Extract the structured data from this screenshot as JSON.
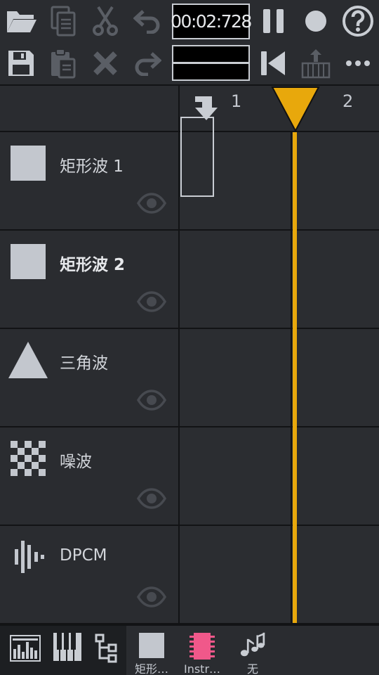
{
  "toolbar": {
    "time": "00:02:728",
    "icons_row1": [
      "open-folder-icon",
      "copy-icon",
      "cut-icon",
      "undo-icon",
      "pause-icon",
      "record-icon",
      "help-icon"
    ],
    "icons_row2": [
      "save-icon",
      "paste-icon",
      "delete-icon",
      "redo-icon",
      "rewind-icon",
      "instrument-export-icon",
      "more-icon"
    ]
  },
  "header": {
    "bars": [
      "1",
      "2"
    ],
    "follow_icon": "arrow-down-follow-icon"
  },
  "channels": [
    {
      "name": "矩形波 1",
      "icon": "square-wave-icon",
      "selected": false
    },
    {
      "name": "矩形波 2",
      "icon": "square-wave-icon",
      "selected": true
    },
    {
      "name": "三角波",
      "icon": "triangle-wave-icon",
      "selected": false
    },
    {
      "name": "噪波",
      "icon": "noise-icon",
      "selected": false
    },
    {
      "name": "DPCM",
      "icon": "dpcm-icon",
      "selected": false
    }
  ],
  "bottombar": {
    "left_icons": [
      "sequencer-icon",
      "piano-roll-icon",
      "project-tree-icon"
    ],
    "items": [
      {
        "label": "矩形…",
        "icon": "square-wave-icon"
      },
      {
        "label": "Instr…",
        "icon": "instrument-chip-icon"
      },
      {
        "label": "无",
        "icon": "music-notes-icon"
      }
    ]
  },
  "colors": {
    "accent": "#e8a80c",
    "chip": "#f0588a",
    "background": "#2a2c30"
  }
}
